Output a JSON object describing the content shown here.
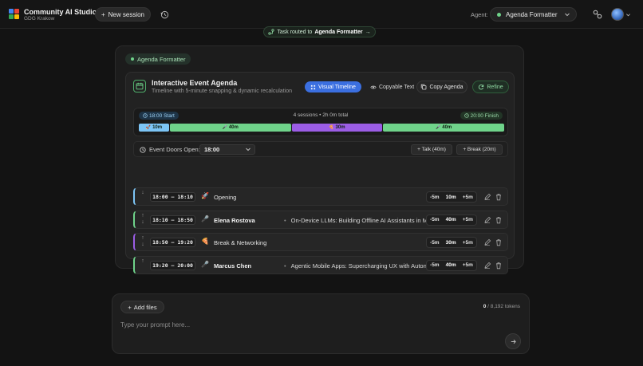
{
  "header": {
    "app_title": "Community AI Studio",
    "app_subtitle": "GDG Krakow",
    "new_session_label": "New session",
    "agent_label": "Agent:",
    "agent_value": "Agenda Formatter"
  },
  "routed": {
    "prefix": "Task routed to",
    "agent": "Agenda Formatter",
    "arrow": "→"
  },
  "card": {
    "agent_badge": "Agenda Formatter",
    "title": "Interactive Event Agenda",
    "subtitle": "Timeline with 5-minute snapping & dynamic recalculation",
    "tabs": [
      {
        "label": "Visual Timeline",
        "active": true
      },
      {
        "label": "Copyable Text",
        "active": false
      }
    ],
    "copy_label": "Copy Agenda",
    "refine_label": "Refine"
  },
  "timeline": {
    "start_label": "18:00 Start",
    "finish_label": "20:00 Finish",
    "summary": "4 sessions • 2h 0m total",
    "segments": [
      {
        "icon": "🚀",
        "label": "10m",
        "minutes": 10,
        "color": "#7cc4f5"
      },
      {
        "icon": "🎤",
        "label": "40m",
        "minutes": 40,
        "color": "#6fd38a"
      },
      {
        "icon": "🍕",
        "label": "30m",
        "minutes": 30,
        "color": "#9b5de5"
      },
      {
        "icon": "🎤",
        "label": "40m",
        "minutes": 40,
        "color": "#6fd38a"
      }
    ]
  },
  "doors": {
    "label": "Event Doors Open:",
    "value": "18:00",
    "add_talk": "+ Talk (40m)",
    "add_break": "+ Break (20m)"
  },
  "sessions": [
    {
      "time": "18:00 – 18:10",
      "emoji": "🚀",
      "title": "Opening",
      "speaker": "",
      "talk": "",
      "duration": "10m",
      "accent": "#7cc4f5",
      "up": "",
      "down": "↓"
    },
    {
      "time": "18:10 – 18:50",
      "emoji": "🎤",
      "title": "",
      "speaker": "Elena Rostova",
      "talk": "On-Device LLMs: Building Offline AI Assistants in Mol",
      "duration": "40m",
      "accent": "#6fd38a",
      "up": "↑",
      "down": "↓"
    },
    {
      "time": "18:50 – 19:20",
      "emoji": "🍕",
      "title": "Break & Networking",
      "speaker": "",
      "talk": "",
      "duration": "30m",
      "accent": "#9b5de5",
      "up": "↑",
      "down": "↓"
    },
    {
      "time": "19:20 – 20:00",
      "emoji": "🎤",
      "title": "",
      "speaker": "Marcus Chen",
      "talk": "Agentic Mobile Apps: Supercharging UX with Autonor",
      "duration": "40m",
      "accent": "#6fd38a",
      "up": "↑",
      "down": ""
    }
  ],
  "stepper": {
    "minus": "-5m",
    "plus": "+5m"
  },
  "prompt": {
    "add_files": "Add files",
    "tokens_used": "0",
    "tokens_total": "/ 8,192 tokens",
    "placeholder": "Type your prompt here..."
  }
}
